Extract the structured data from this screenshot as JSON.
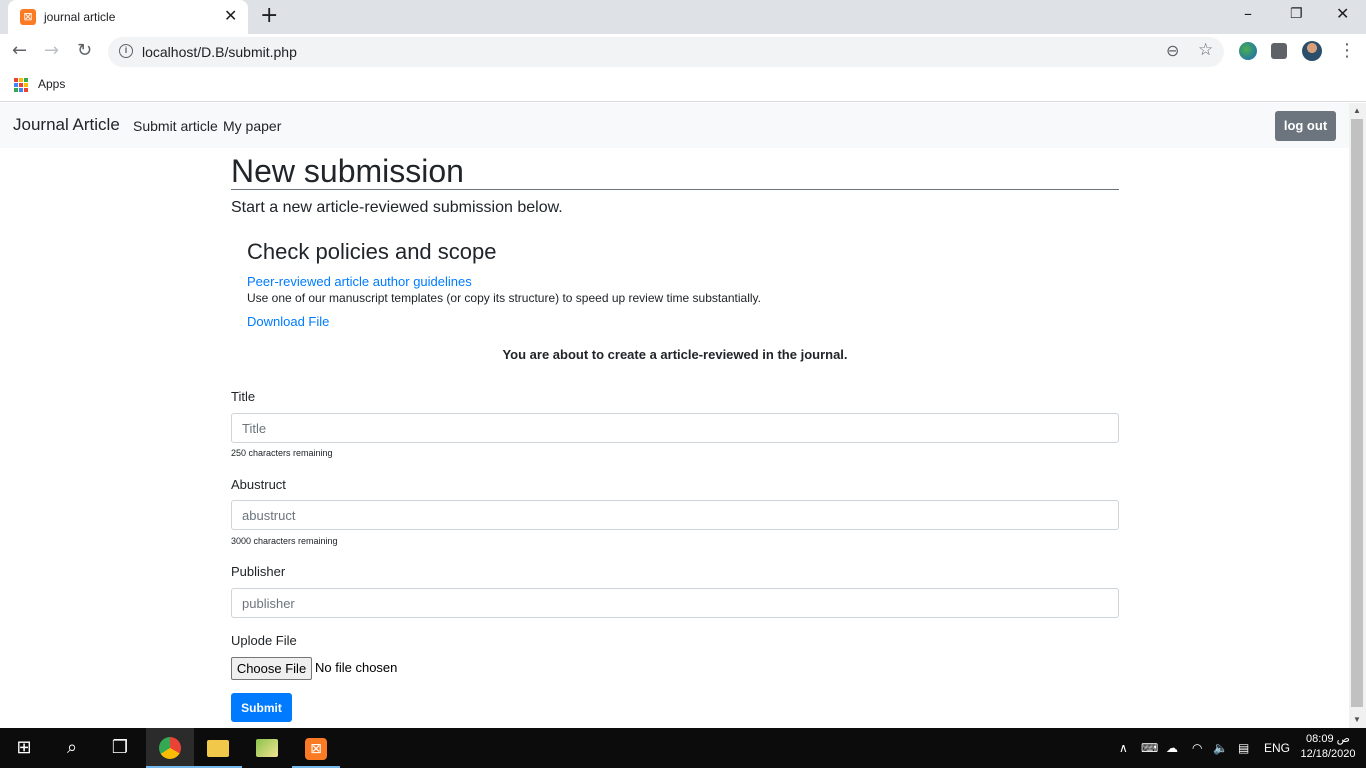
{
  "browser": {
    "tab_title": "journal article",
    "favicon_glyph": "⊠",
    "close_glyph": "✕",
    "new_tab_glyph": "+",
    "url": "localhost/D.B/submit.php",
    "bookmarks": {
      "apps_label": "Apps"
    },
    "window_controls": {
      "minimize": "–",
      "restore": "❐",
      "close": "✕"
    },
    "nav": {
      "back": "←",
      "forward": "→",
      "reload": "↻",
      "zoom": "⊖",
      "star": "☆",
      "menu": "⋮"
    }
  },
  "navbar": {
    "brand": "Journal Article",
    "links": [
      "Submit article",
      "My paper"
    ],
    "logout_label": "log out"
  },
  "main": {
    "heading": "New submission",
    "lead": "Start a new article-reviewed submission below.",
    "policies_heading": "Check policies and scope",
    "guidelines_link": "Peer-reviewed article author guidelines",
    "templates_text": "Use one of our manuscript templates (or copy its structure) to speed up review time substantially.",
    "download_link": "Download File",
    "notice": "You are about to create a article-reviewed in the journal."
  },
  "form": {
    "title_label": "Title",
    "title_placeholder": "Title",
    "title_counter": "250 characters remaining",
    "abstract_label": "Abustruct",
    "abstract_placeholder": "abustruct",
    "abstract_counter": "3000 characters remaining",
    "publisher_label": "Publisher",
    "publisher_placeholder": "publisher",
    "upload_label": "Uplode File",
    "choose_file_label": "Choose File",
    "no_file_text": "No file chosen",
    "submit_label": "Submit"
  },
  "taskbar": {
    "language": "ENG",
    "time": "08:09 ص",
    "date": "12/18/2020"
  },
  "colors": {
    "primary": "#007bff",
    "secondary": "#6c757d",
    "navbar_bg": "#f8f9fa",
    "taskbar_bg": "#0c0c0c"
  }
}
